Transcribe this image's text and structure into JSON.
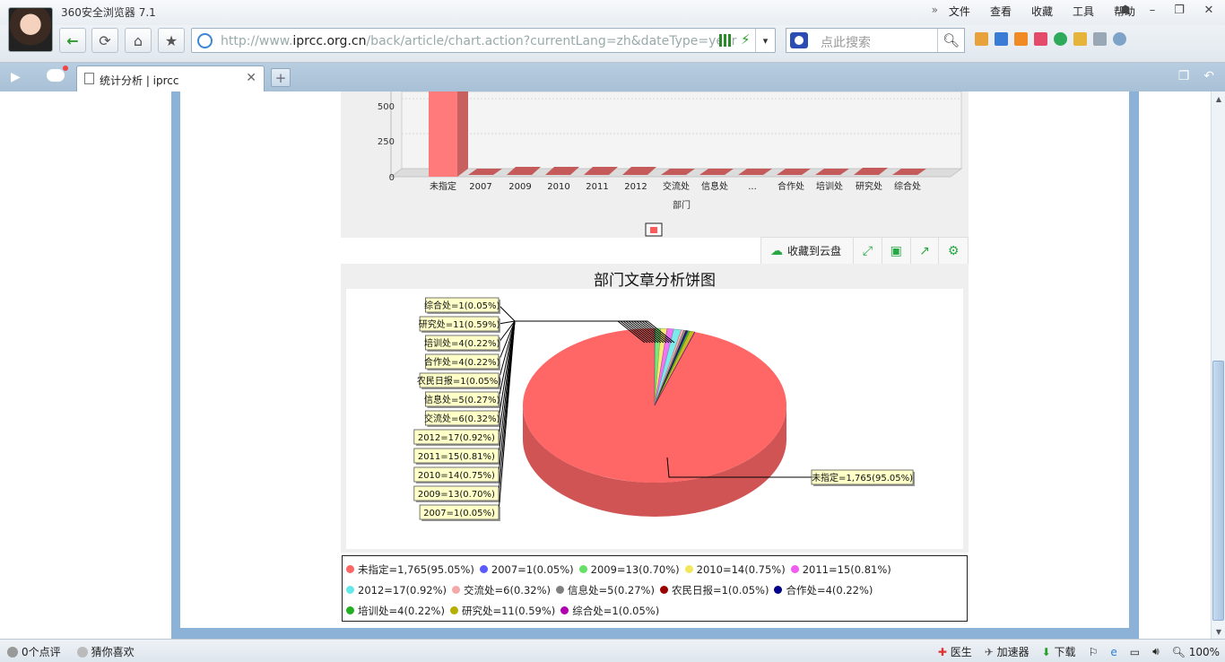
{
  "window": {
    "app_title": "360安全浏览器 7.1",
    "menu": [
      "文件",
      "查看",
      "收藏",
      "工具",
      "帮助"
    ]
  },
  "toolbar": {
    "url_prefix": "http://www.",
    "url_domain": "iprcc.org.cn",
    "url_path": "/back/article/chart.action?currentLang=zh&dateType=year",
    "search_placeholder": "点此搜索"
  },
  "tab": {
    "title": "统计分析 | iprcc"
  },
  "chart_toolbar": {
    "save_label": "收藏到云盘"
  },
  "bar_chart": {
    "yticks": [
      "500",
      "250",
      "0"
    ],
    "categories": [
      "未指定",
      "2007",
      "2009",
      "2010",
      "2011",
      "2012",
      "交流处",
      "信息处",
      "...",
      "合作处",
      "培训处",
      "研究处",
      "综合处"
    ],
    "xlabel": "部门"
  },
  "chart_data": {
    "type": "pie",
    "title": "部门文章分析饼图",
    "slices": [
      {
        "label": "未指定",
        "value": 1765,
        "percent": "95.05%",
        "color": "#ff6666",
        "text": "未指定=1,765(95.05%)"
      },
      {
        "label": "2007",
        "value": 1,
        "percent": "0.05%",
        "color": "#5a5aff",
        "text": "2007=1(0.05%)"
      },
      {
        "label": "2009",
        "value": 13,
        "percent": "0.70%",
        "color": "#66e066",
        "text": "2009=13(0.70%)"
      },
      {
        "label": "2010",
        "value": 14,
        "percent": "0.75%",
        "color": "#f2e65c",
        "text": "2010=14(0.75%)"
      },
      {
        "label": "2011",
        "value": 15,
        "percent": "0.81%",
        "color": "#f05cf0",
        "text": "2011=15(0.81%)"
      },
      {
        "label": "2012",
        "value": 17,
        "percent": "0.92%",
        "color": "#66e8e8",
        "text": "2012=17(0.92%)"
      },
      {
        "label": "交流处",
        "value": 6,
        "percent": "0.32%",
        "color": "#f4a8a8",
        "text": "交流处=6(0.32%)"
      },
      {
        "label": "信息处",
        "value": 5,
        "percent": "0.27%",
        "color": "#808080",
        "text": "信息处=5(0.27%)"
      },
      {
        "label": "农民日报",
        "value": 1,
        "percent": "0.05%",
        "color": "#9b0000",
        "text": "农民日报=1(0.05%)"
      },
      {
        "label": "合作处",
        "value": 4,
        "percent": "0.22%",
        "color": "#00008b",
        "text": "合作处=4(0.22%)"
      },
      {
        "label": "培训处",
        "value": 4,
        "percent": "0.22%",
        "color": "#22b022",
        "text": "培训处=4(0.22%)"
      },
      {
        "label": "研究处",
        "value": 11,
        "percent": "0.59%",
        "color": "#b5b000",
        "text": "研究处=11(0.59%)"
      },
      {
        "label": "综合处",
        "value": 1,
        "percent": "0.05%",
        "color": "#b000b0",
        "text": "综合处=1(0.05%)"
      }
    ]
  },
  "statusbar": {
    "comments": "0个点评",
    "guess": "猜你喜欢",
    "doctor": "医生",
    "accelerator": "加速器",
    "download": "下载",
    "zoom": "100%"
  }
}
